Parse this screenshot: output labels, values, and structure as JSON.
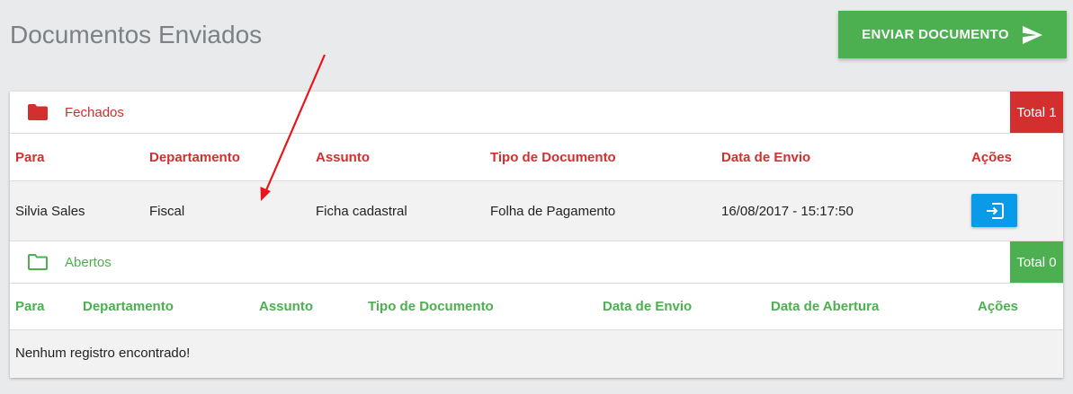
{
  "header": {
    "title": "Documentos Enviados",
    "send_button_label": "ENVIAR DOCUMENTO"
  },
  "colors": {
    "red": "#d32f2f",
    "green": "#4caf50",
    "blue": "#0a9be8"
  },
  "closed": {
    "label": "Fechados",
    "total": "Total 1",
    "columns": [
      "Para",
      "Departamento",
      "Assunto",
      "Tipo de Documento",
      "Data de Envio",
      "Ações"
    ],
    "rows": [
      {
        "para": "Silvia Sales",
        "departamento": "Fiscal",
        "assunto": "Ficha cadastral",
        "tipo": "Folha de Pagamento",
        "data_envio": "16/08/2017 - 15:17:50"
      }
    ]
  },
  "open": {
    "label": "Abertos",
    "total": "Total 0",
    "columns": [
      "Para",
      "Departamento",
      "Assunto",
      "Tipo de Documento",
      "Data de Envio",
      "Data de Abertura",
      "Ações"
    ],
    "empty_message": "Nenhum registro encontrado!"
  }
}
